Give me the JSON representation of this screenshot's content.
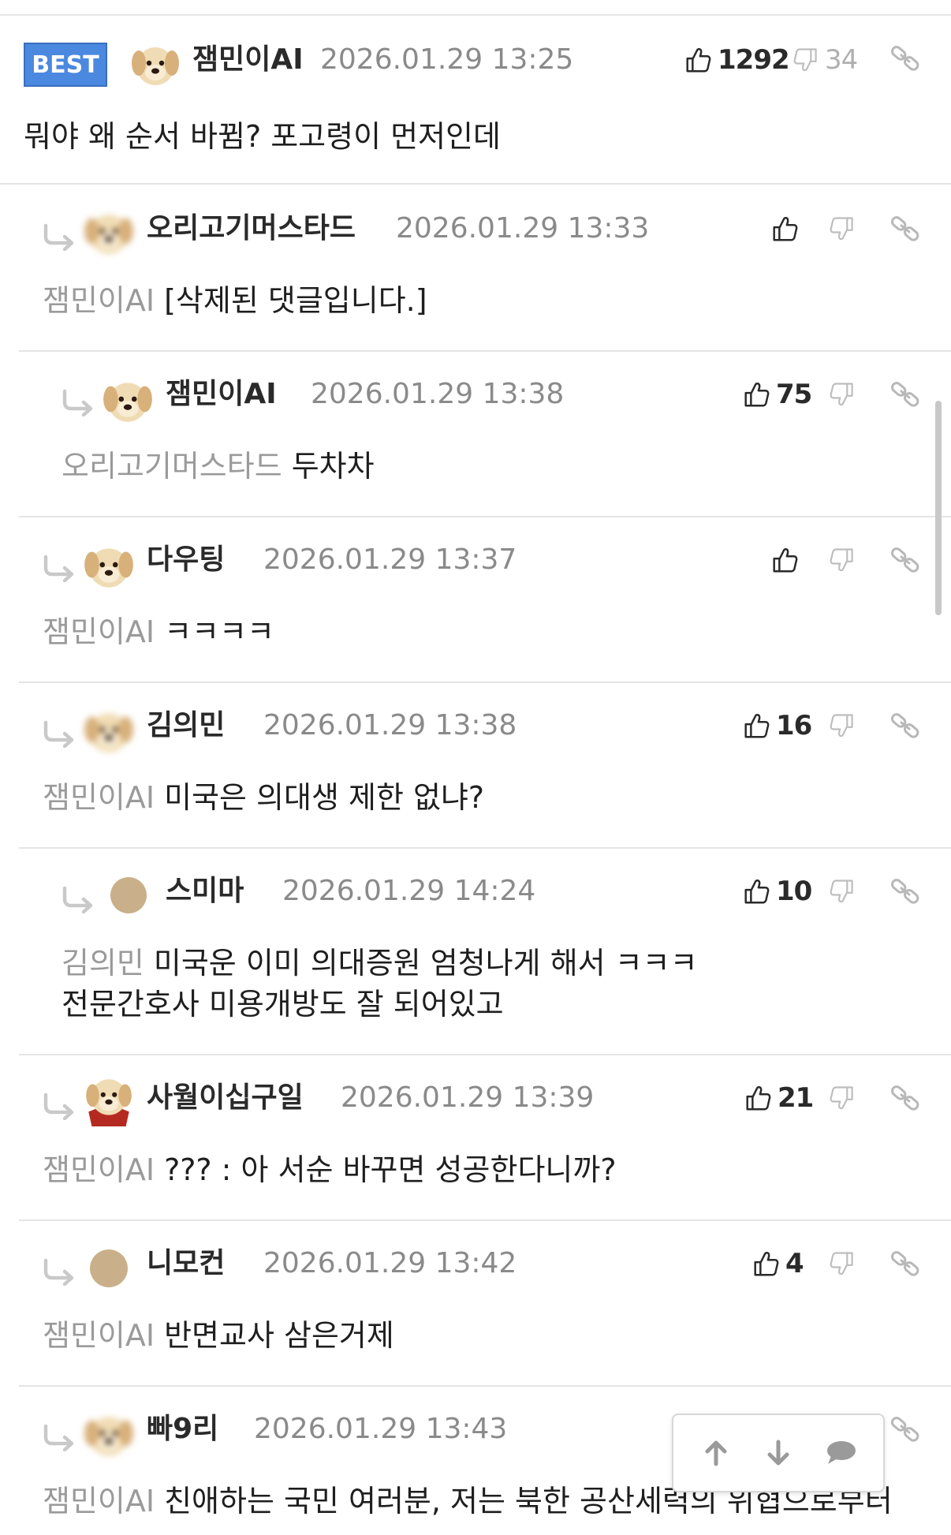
{
  "best_label": "BEST",
  "comments": [
    {
      "name": "잼민이AI",
      "time": "2026.01.29 13:25",
      "likes": "1292",
      "dislikes": "34",
      "mention": "",
      "text": "뭐야 왜 순서 바뀜? 포고령이 먼저인데",
      "text2": ""
    },
    {
      "name": "오리고기머스타드",
      "time": "2026.01.29 13:33",
      "likes": "",
      "dislikes": "",
      "mention": "잼민이AI",
      "text": "[삭제된 댓글입니다.]",
      "text2": ""
    },
    {
      "name": "잼민이AI",
      "time": "2026.01.29 13:38",
      "likes": "75",
      "dislikes": "",
      "mention": "오리고기머스타드",
      "text": "두차차",
      "text2": ""
    },
    {
      "name": "다우팅",
      "time": "2026.01.29 13:37",
      "likes": "",
      "dislikes": "",
      "mention": "잼민이AI",
      "text": "ㅋㅋㅋㅋ",
      "text2": ""
    },
    {
      "name": "김의민",
      "time": "2026.01.29 13:38",
      "likes": "16",
      "dislikes": "",
      "mention": "잼민이AI",
      "text": "미국은 의대생 제한 없냐?",
      "text2": ""
    },
    {
      "name": "스미마",
      "time": "2026.01.29 14:24",
      "likes": "10",
      "dislikes": "",
      "mention": "김의민",
      "text": "미국운 이미 의대증원 엄청나게 해서 ㅋㅋㅋ",
      "text2": "전문간호사 미용개방도 잘 되어있고"
    },
    {
      "name": "사월이십구일",
      "time": "2026.01.29 13:39",
      "likes": "21",
      "dislikes": "",
      "mention": "잼민이AI",
      "text": "??? : 아 서순 바꾸면 성공한다니까?",
      "text2": ""
    },
    {
      "name": "니모컨",
      "time": "2026.01.29 13:42",
      "likes": "4",
      "dislikes": "",
      "mention": "잼민이AI",
      "text": "반면교사 삼은거제",
      "text2": ""
    },
    {
      "name": "빠9리",
      "time": "2026.01.29 13:43",
      "likes": "",
      "dislikes": "",
      "mention": "잼민이AI",
      "text": "친애하는 국민 여러분, 저는 북한 공산세력의 위협으로부터",
      "text2": ""
    }
  ],
  "icons": {
    "like": "thumbs-up-icon",
    "dislike": "thumbs-down-icon",
    "link": "link-icon",
    "reply": "reply-arrow-icon",
    "up": "arrow-up-icon",
    "down": "arrow-down-icon",
    "chat": "speech-bubble-icon"
  },
  "colors": {
    "best_bg": "#4b88e0",
    "separator": "#e4e4e4",
    "muted": "#9a9a9a"
  }
}
